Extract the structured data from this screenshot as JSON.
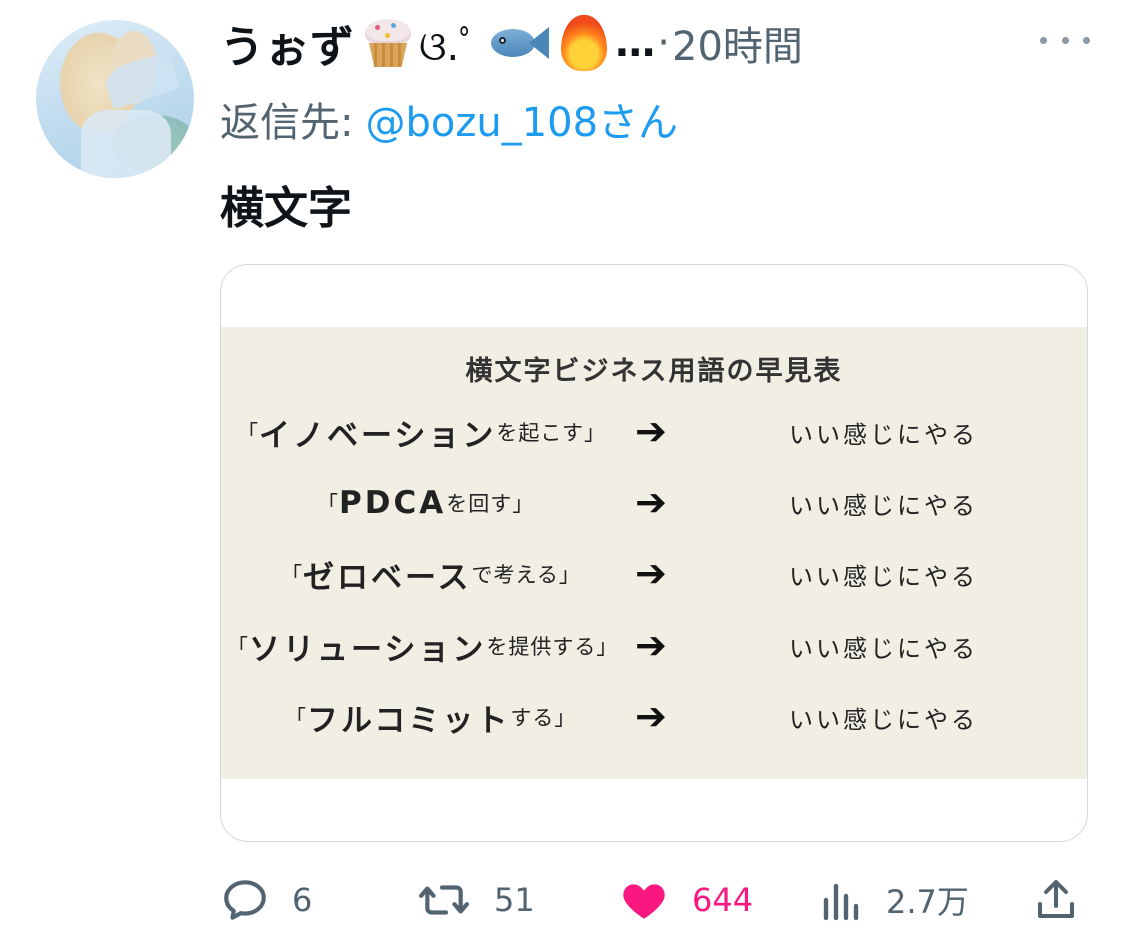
{
  "tweet": {
    "display_name": "うぉず",
    "name_symbols": "ଓ.ﾟ",
    "name_ellipsis": "…",
    "separator": "·",
    "time": "20時間",
    "reply_label": "返信先:",
    "reply_handle": "@bozu_108さん",
    "text": "横文字"
  },
  "card": {
    "title": "横文字ビジネス用語の早見表",
    "arrow": "➔",
    "rows": [
      {
        "open": "「",
        "term": "イノベーション",
        "suffix": "を起こす",
        "close": "」",
        "result": "いい感じにやる"
      },
      {
        "open": "「",
        "term": "PDCA",
        "suffix": "を回す",
        "close": "」",
        "result": "いい感じにやる"
      },
      {
        "open": "「",
        "term": "ゼロベース",
        "suffix": "で考える",
        "close": "」",
        "result": "いい感じにやる"
      },
      {
        "open": "「",
        "term": "ソリューション",
        "suffix": "を提供する",
        "close": "」",
        "result": "いい感じにやる"
      },
      {
        "open": "「",
        "term": "フルコミット",
        "suffix": "する",
        "close": "」",
        "result": "いい感じにやる"
      }
    ]
  },
  "actions": {
    "replies": "6",
    "retweets": "51",
    "likes": "644",
    "views": "2.7万"
  },
  "colors": {
    "accent": "#1d9bf0",
    "like": "#f91880",
    "muted": "#536471",
    "card_bg": "#f1eee3"
  },
  "icons": [
    "cupcake-emoji",
    "fish-emoji",
    "fire-emoji",
    "more-icon",
    "reply-icon",
    "retweet-icon",
    "like-icon",
    "views-icon",
    "share-icon"
  ]
}
